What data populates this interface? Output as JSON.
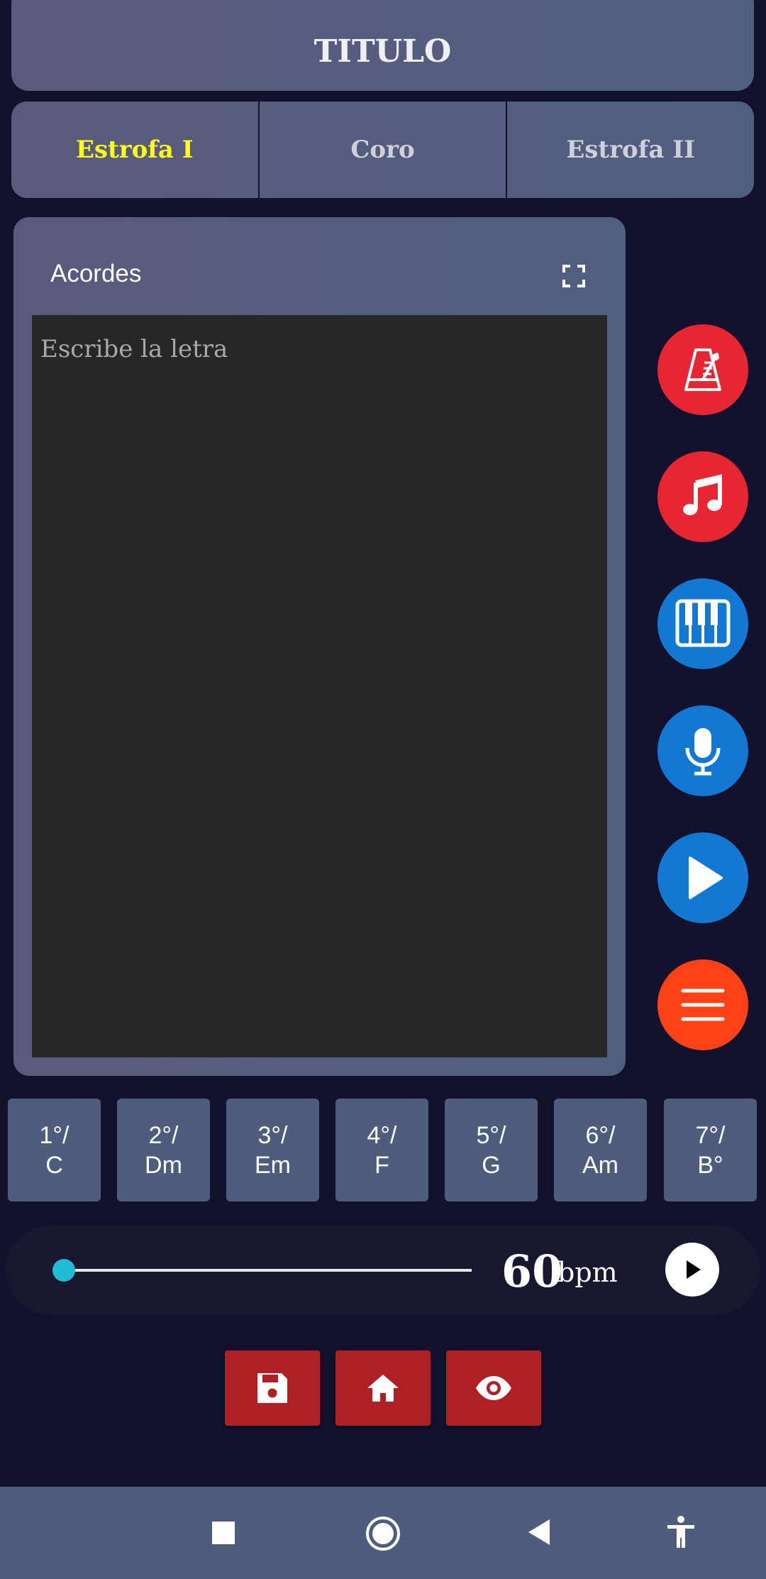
{
  "header": {
    "title": "TITULO"
  },
  "tabs": [
    {
      "label": "Estrofa I",
      "active": true
    },
    {
      "label": "Coro",
      "active": false
    },
    {
      "label": "Estrofa II",
      "active": false
    }
  ],
  "panel": {
    "header_label": "Acordes",
    "lyrics_placeholder": "Escribe la letra",
    "lyrics_value": ""
  },
  "side_buttons": [
    {
      "name": "metronome",
      "icon": "metronome-icon",
      "color": "#e62631"
    },
    {
      "name": "music",
      "icon": "music-note-icon",
      "color": "#e62631"
    },
    {
      "name": "piano",
      "icon": "piano-icon",
      "color": "#1278d2"
    },
    {
      "name": "record",
      "icon": "microphone-icon",
      "color": "#1278d2"
    },
    {
      "name": "play",
      "icon": "play-icon",
      "color": "#1278d2"
    },
    {
      "name": "menu",
      "icon": "menu-icon",
      "color": "#ff4216"
    }
  ],
  "degrees": [
    {
      "degree": "1°/",
      "chord": "C"
    },
    {
      "degree": "2°/",
      "chord": "Dm"
    },
    {
      "degree": "3°/",
      "chord": "Em"
    },
    {
      "degree": "4°/",
      "chord": "F"
    },
    {
      "degree": "5°/",
      "chord": "G"
    },
    {
      "degree": "6°/",
      "chord": "Am"
    },
    {
      "degree": "7°/",
      "chord": "B°"
    }
  ],
  "bpm": {
    "value": "60",
    "unit": "bpm",
    "slider_fraction": 0.0
  },
  "actions": [
    {
      "name": "save",
      "icon": "save-icon"
    },
    {
      "name": "home",
      "icon": "home-icon"
    },
    {
      "name": "view",
      "icon": "eye-icon"
    }
  ],
  "colors": {
    "background": "#13122e",
    "active_tab": "#ffff1a",
    "action_red": "#b01f23",
    "slider_thumb": "#1fbcd3"
  }
}
